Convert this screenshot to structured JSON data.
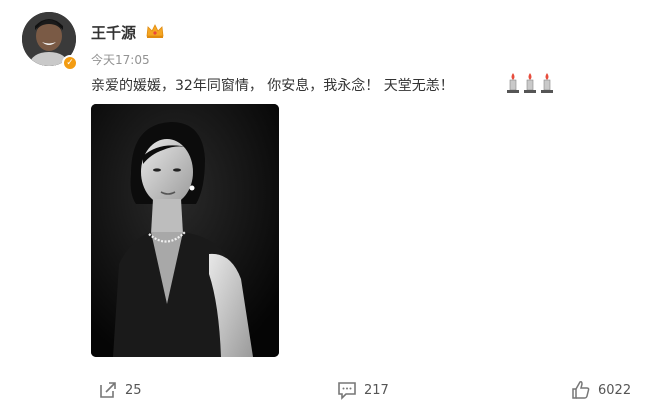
{
  "post": {
    "author": {
      "name": "王千源",
      "avatar_icon": "user-avatar",
      "verified_icon": "verified-badge-icon",
      "badge_icon": "crown-icon"
    },
    "timestamp": "今天17:05",
    "text": "亲爱的媛媛，32年同窗情， 你安息，我永念！ 天堂无恙！",
    "emoji": [
      "candle-icon",
      "candle-icon",
      "candle-icon"
    ],
    "image": "black-and-white-portrait-photo"
  },
  "actions": {
    "share": {
      "icon": "share-icon",
      "count": "25"
    },
    "comment": {
      "icon": "comment-icon",
      "count": "217"
    },
    "like": {
      "icon": "thumbs-up-icon",
      "count": "6022"
    }
  },
  "colors": {
    "text": "#333333",
    "muted": "#939393",
    "icon": "#777777",
    "verified": "#f39c12"
  }
}
